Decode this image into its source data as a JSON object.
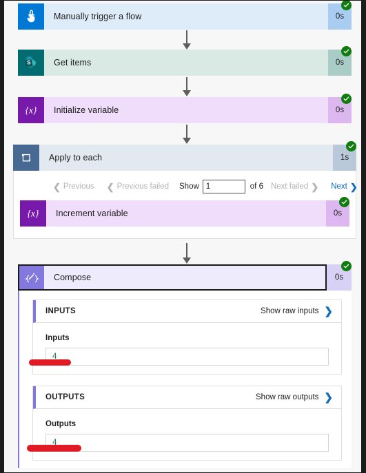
{
  "flow": {
    "steps": [
      {
        "name": "trigger",
        "title": "Manually trigger a flow",
        "duration": "0s",
        "icon": "touch-hand-icon",
        "icon_bg": "#0078d4",
        "body_bg": "#deecfa",
        "dur_bg": "#a9cdf0",
        "status": "succeeded"
      },
      {
        "name": "get-items",
        "title": "Get items",
        "duration": "0s",
        "icon": "sharepoint-icon",
        "icon_bg": "#036c70",
        "body_bg": "#d9e9e4",
        "dur_bg": "#a9cdc6",
        "status": "succeeded"
      },
      {
        "name": "initialize-variable",
        "title": "Initialize variable",
        "duration": "0s",
        "icon": "variable-braces-icon",
        "icon_bg": "#7719aa",
        "body_bg": "#f0ddfb",
        "dur_bg": "#ddb8f0",
        "status": "succeeded"
      },
      {
        "name": "apply-to-each",
        "title": "Apply to each",
        "duration": "1s",
        "icon": "loop-repeat-icon",
        "icon_bg": "#486991",
        "body_bg": "#e3e9f0",
        "dur_bg": "#bac9d9",
        "status": "succeeded"
      },
      {
        "name": "increment-variable",
        "title": "Increment variable",
        "duration": "0s",
        "icon": "variable-braces-icon",
        "icon_bg": "#7719aa",
        "body_bg": "#f0ddfb",
        "dur_bg": "#ddb8f0",
        "status": "succeeded"
      },
      {
        "name": "compose",
        "title": "Compose",
        "duration": "0s",
        "icon": "compose-pen-icon",
        "icon_bg": "#8378de",
        "body_bg": "#eeebfc",
        "dur_bg": "#d7d1f5",
        "status": "succeeded"
      }
    ]
  },
  "pager": {
    "previous_label": "Previous",
    "previous_failed_label": "Previous failed",
    "show_label": "Show",
    "page_value": "1",
    "of_label": "of 6",
    "next_failed_label": "Next failed",
    "next_label": "Next"
  },
  "compose_details": {
    "inputs": {
      "header": "INPUTS",
      "raw_link": "Show raw inputs",
      "field_label": "Inputs",
      "value": "4"
    },
    "outputs": {
      "header": "OUTPUTS",
      "raw_link": "Show raw outputs",
      "field_label": "Outputs",
      "value": "4"
    }
  },
  "colors": {
    "success_green": "#107c10",
    "link_blue": "#0f6cbd",
    "annotation_red": "#e01b24",
    "value_green": "#217a4b"
  }
}
